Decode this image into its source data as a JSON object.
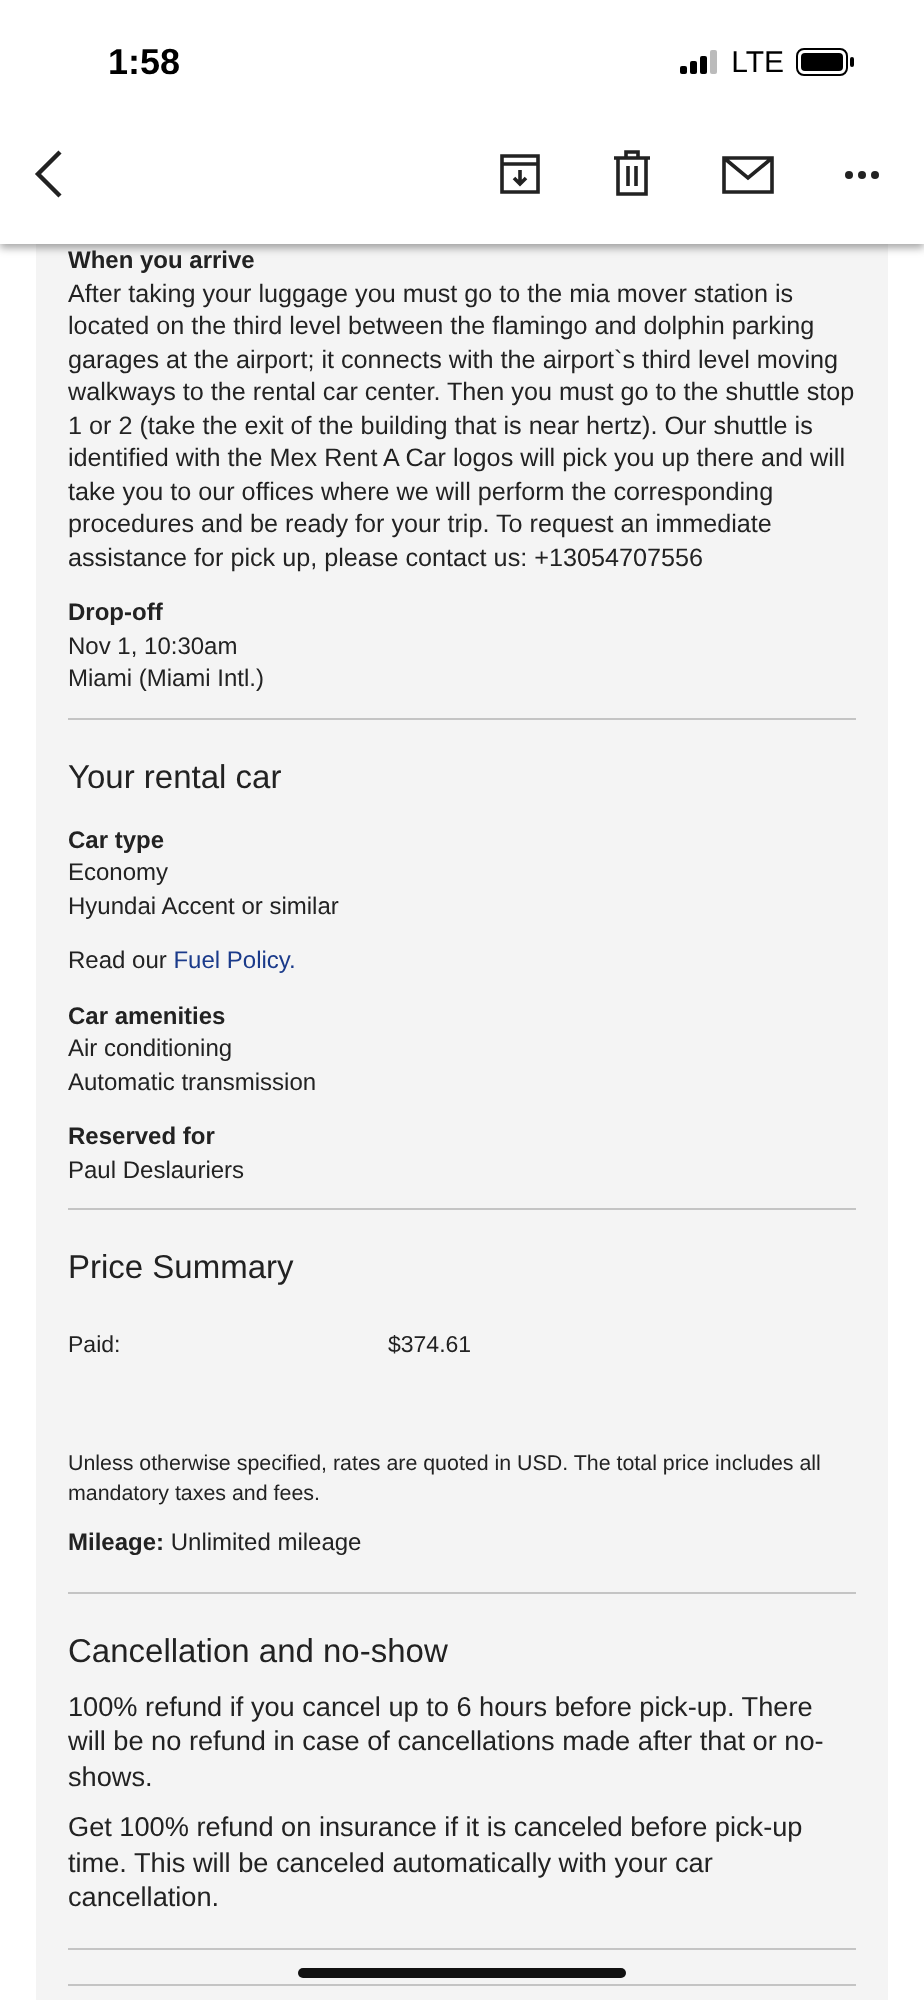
{
  "status_bar": {
    "time": "1:58",
    "network": "LTE"
  },
  "pickup_dropoff": {
    "arrival": {
      "label": "When you arrive",
      "text": "After taking your luggage you must go to the mia mover station is located on the third level between the flamingo and dolphin parking garages at the airport; it connects with the airport`s third level moving walkways to the rental car center. Then you must go to the shuttle stop 1 or 2 (take the exit of the building that is near hertz). Our shuttle is identified with the Mex Rent A Car logos will pick you up there and will take you to our offices where we will perform the corresponding procedures and be ready for your trip. To request an immediate assistance for pick up, please contact us: +13054707556"
    },
    "dropoff": {
      "label": "Drop-off",
      "date": "Nov 1, 10:30am",
      "location": "Miami (Miami Intl.)"
    }
  },
  "rental_car": {
    "title": "Your rental car",
    "groups": [
      {
        "kind": "details",
        "label": "Car type",
        "lines": [
          "Economy",
          "Hyundai Accent or similar"
        ]
      },
      {
        "kind": "note",
        "text": "Read our",
        "link": "Fuel Policy."
      },
      {
        "kind": "details",
        "label": "Car amenities",
        "lines": [
          "Air conditioning",
          "Automatic transmission"
        ]
      },
      {
        "kind": "details",
        "label": "Reserved for",
        "lines": [
          "Paul Deslauriers"
        ]
      }
    ]
  },
  "price_summary": {
    "title": "Price Summary",
    "rows": [
      {
        "label": "Paid:",
        "value": "$374.61"
      }
    ],
    "disclaimer": "Unless otherwise specified, rates are quoted in USD. The total price includes all mandatory taxes and fees.",
    "mileage": "**Mileage:** Unlimited mileage"
  },
  "cancellation": {
    "title": "Cancellation and no-show",
    "paragraphs": [
      "100% refund if you cancel up to 6 hours before pick-up. There will be no refund in case of cancellations made after that or no-shows.",
      "Get 100% refund on insurance if it is canceled before pick-up time. This will be canceled automatically with your car cancellation."
    ]
  }
}
